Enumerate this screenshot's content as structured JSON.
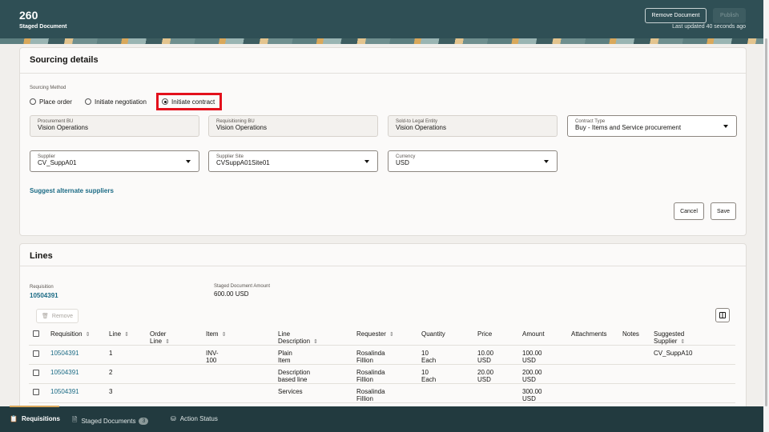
{
  "header": {
    "number": "260",
    "subtitle": "Staged Document",
    "remove_label": "Remove Document",
    "publish_label": "Publish",
    "last_updated": "Last updated 40 seconds ago"
  },
  "sourcing": {
    "title": "Sourcing details",
    "method_label": "Sourcing Method",
    "options": [
      "Place order",
      "Initiate negotiation",
      "Initiate contract"
    ],
    "selected": "Initiate contract",
    "fields": [
      {
        "label": "Procurement BU",
        "value": "Vision Operations"
      },
      {
        "label": "Requisitioning BU",
        "value": "Vision Operations"
      },
      {
        "label": "Sold-to Legal Entity",
        "value": "Vision Operations"
      },
      {
        "label": "Contract Type",
        "value": "Buy - Items and Service procurement"
      },
      {
        "label": "Supplier",
        "value": "CV_SuppA01"
      },
      {
        "label": "Supplier Site",
        "value": "CVSuppA01Site01"
      },
      {
        "label": "Currency",
        "value": "USD"
      }
    ],
    "suggest_link": "Suggest alternate suppliers",
    "cancel_label": "Cancel",
    "save_label": "Save"
  },
  "lines": {
    "title": "Lines",
    "req_label": "Requisition",
    "req_value": "10504391",
    "amount_label": "Staged Document Amount",
    "amount_value": "600.00 USD",
    "remove_label": "Remove",
    "columns": [
      "Requisition",
      "Line",
      "Order Line",
      "Item",
      "Line Description",
      "Requester",
      "Quantity",
      "Price",
      "Amount",
      "Attachments",
      "Notes",
      "Suggested Supplier"
    ],
    "rows": [
      [
        "10504391",
        "1",
        "",
        "INV-100",
        "Plain Item",
        "Rosalinda Fillion",
        "10 Each",
        "10.00 USD",
        "100.00 USD",
        "",
        "",
        "CV_SuppA10"
      ],
      [
        "10504391",
        "2",
        "",
        "",
        "Description based line",
        "Rosalinda Fillion",
        "10 Each",
        "20.00 USD",
        "200.00 USD",
        "",
        "",
        ""
      ],
      [
        "10504391",
        "3",
        "",
        "",
        "Services",
        "Rosalinda Fillion",
        "",
        "",
        "300.00 USD",
        "",
        "",
        ""
      ]
    ]
  },
  "footer": {
    "tabs": [
      {
        "label": "Requisitions"
      },
      {
        "label": "Staged Documents",
        "badge": "3"
      },
      {
        "label": "Action Status"
      }
    ]
  }
}
